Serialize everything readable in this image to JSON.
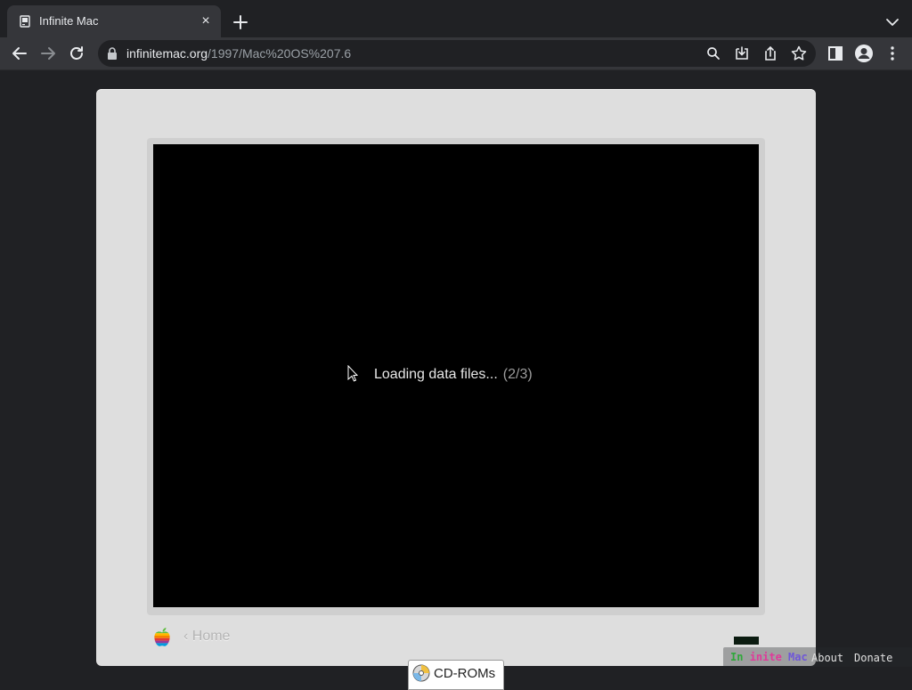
{
  "browser": {
    "tab": {
      "title": "Infinite Mac",
      "favicon": "mac-favicon-icon",
      "close_label": "×"
    },
    "url": {
      "host": "infinitemac.org",
      "path": "/1997/Mac%20OS%207.6"
    }
  },
  "emulator": {
    "status_text": "Loading data files...",
    "status_count": "(2/3)",
    "home_label": "‹ Home"
  },
  "footer": {
    "brand_parts": [
      "In",
      "inite",
      "Mac"
    ],
    "brand_colors": [
      "#2fa83a",
      "#e0399a",
      "#6f57d8",
      "#a8a8a8"
    ],
    "about": "About",
    "donate": "Donate"
  },
  "cdrom": {
    "label": "CD-ROMs"
  },
  "colors": {
    "chrome_dark": "#202124",
    "chrome_toolbar": "#35363a",
    "bezel": "#dedede",
    "screen": "#000000"
  }
}
